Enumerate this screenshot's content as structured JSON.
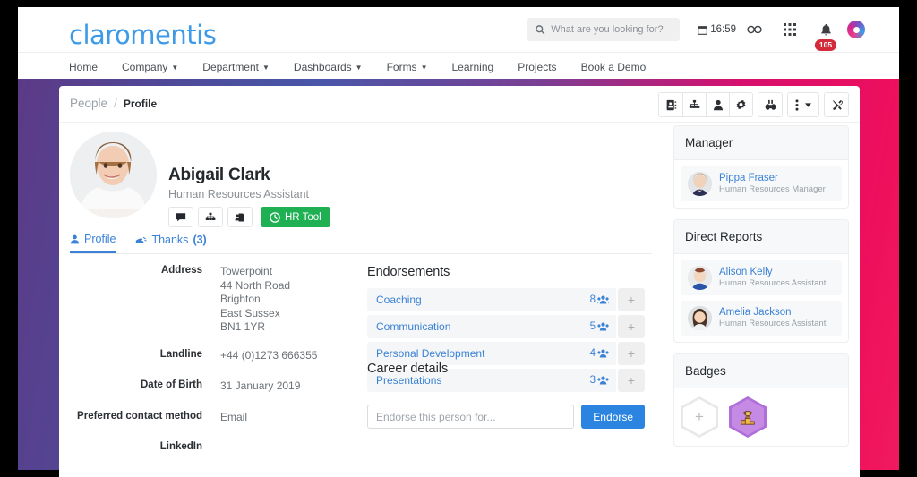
{
  "header": {
    "logo_text": "claromentis",
    "search": {
      "placeholder": "What are you looking for?",
      "value": "",
      "icon": "search-icon"
    },
    "clock": {
      "time": "16:59",
      "icon": "calendar-icon"
    },
    "links_icon": "links-icon",
    "apps_icon": "grid-apps-icon",
    "notifications": {
      "icon": "bell-icon",
      "count": "105"
    },
    "user_avatar_icon": "user-avatar-icon"
  },
  "nav": {
    "items": [
      {
        "label": "Home",
        "has_caret": false
      },
      {
        "label": "Company",
        "has_caret": true
      },
      {
        "label": "Department",
        "has_caret": true
      },
      {
        "label": "Dashboards",
        "has_caret": true
      },
      {
        "label": "Forms",
        "has_caret": true
      },
      {
        "label": "Learning",
        "has_caret": false
      },
      {
        "label": "Projects",
        "has_caret": false
      },
      {
        "label": "Book a Demo",
        "has_caret": false
      }
    ],
    "caret_glyph": "▼"
  },
  "breadcrumb": {
    "root": "People",
    "separator": "/",
    "current": "Profile"
  },
  "page_toolbar": {
    "buttons": [
      {
        "name": "address-book-icon",
        "glyph": "📓"
      },
      {
        "name": "org-chart-icon",
        "glyph": "⑂"
      },
      {
        "name": "person-icon",
        "glyph": "👤"
      },
      {
        "name": "gear-icon",
        "glyph": "⚙"
      },
      {
        "name": "binoculars-icon",
        "glyph": "🔭"
      },
      {
        "name": "more-options-icon",
        "glyph": "⋮"
      },
      {
        "name": "tools-icon",
        "glyph": "⚒"
      }
    ]
  },
  "profile": {
    "avatar_name": "profile-avatar",
    "name": "Abigail Clark",
    "job_title": "Human Resources Assistant",
    "actions": [
      {
        "name": "message-icon",
        "glyph": "💬"
      },
      {
        "name": "org-chart-icon",
        "glyph": "⑂"
      },
      {
        "name": "share-profile-icon",
        "glyph": "🗂"
      }
    ],
    "hr_tool_button": {
      "label": "HR Tool",
      "icon": "clock-icon",
      "color": "#1fb054"
    }
  },
  "tabs": [
    {
      "label": "Profile",
      "icon": "person-icon",
      "active": true,
      "count": ""
    },
    {
      "label": "Thanks",
      "icon": "thanks-hand-icon",
      "active": false,
      "count": "(3)"
    }
  ],
  "details": [
    {
      "label": "Address",
      "value": "Towerpoint\n44 North Road\nBrighton\nEast Sussex\nBN1 1YR"
    },
    {
      "label": "Landline",
      "value": "+44 (0)1273 666355"
    },
    {
      "label": "Date of Birth",
      "value": "31 January 2019"
    },
    {
      "label": "Preferred contact method",
      "value": "Email"
    },
    {
      "label": "LinkedIn",
      "value": ""
    }
  ],
  "endorsements": {
    "heading": "Endorsements",
    "people_icon": "people-group-icon",
    "add_glyph": "+",
    "items": [
      {
        "name": "Coaching",
        "count": "8"
      },
      {
        "name": "Communication",
        "count": "5"
      },
      {
        "name": "Personal Development",
        "count": "4"
      },
      {
        "name": "Presentations",
        "count": "3"
      }
    ],
    "input_placeholder": "Endorse this person for...",
    "input_value": "",
    "submit_label": "Endorse",
    "submit_color": "#2b85e0"
  },
  "career": {
    "heading": "Career details"
  },
  "manager": {
    "heading": "Manager",
    "people": [
      {
        "name": "Pippa Fraser",
        "role": "Human Resources Manager"
      }
    ]
  },
  "direct_reports": {
    "heading": "Direct Reports",
    "people": [
      {
        "name": "Alison Kelly",
        "role": "Human Resources Assistant"
      },
      {
        "name": "Amelia Jackson",
        "role": "Human Resources Assistant"
      }
    ]
  },
  "badges": {
    "heading": "Badges",
    "add_glyph": "+",
    "items": [
      {
        "name": "trophy-badge",
        "glyph": "🏆",
        "color": "#b06fd8"
      }
    ]
  },
  "theme": {
    "link_blue": "#3b82d6",
    "logo_blue": "#3d9ae8",
    "gradient_start": "#5c3a87",
    "gradient_end": "#f01a5e",
    "badge_red": "#d32b3a"
  }
}
